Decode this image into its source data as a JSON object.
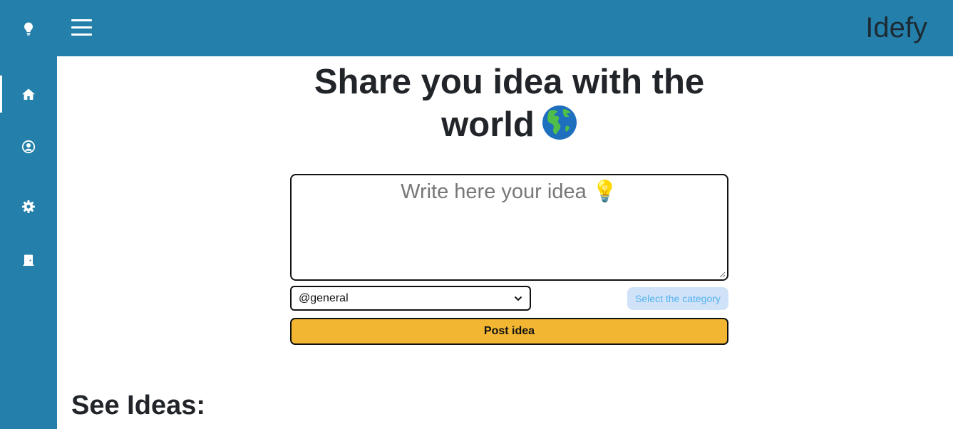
{
  "app": {
    "brand": "Idefy"
  },
  "sidebar": {
    "items": [
      {
        "name": "logo",
        "icon": "lightbulb-icon"
      },
      {
        "name": "home",
        "icon": "home-icon",
        "active": true
      },
      {
        "name": "profile",
        "icon": "user-circle-icon"
      },
      {
        "name": "settings",
        "icon": "gear-icon"
      },
      {
        "name": "logout",
        "icon": "door-exit-icon"
      }
    ]
  },
  "header": {
    "menu_icon": "hamburger-menu-icon"
  },
  "hero": {
    "title": "Share you idea with the world",
    "emoji_icon": "globe-americas-icon"
  },
  "form": {
    "idea_placeholder": "Write here your idea 💡",
    "idea_value": "",
    "category_selected": "@general",
    "category_hint": "Select the category",
    "post_label": "Post idea"
  },
  "feed": {
    "heading": "See Ideas:"
  },
  "colors": {
    "primary": "#2480aa",
    "accent": "#f2b632",
    "hint_bg": "#cfe2f8",
    "hint_text": "#56b3f0"
  }
}
